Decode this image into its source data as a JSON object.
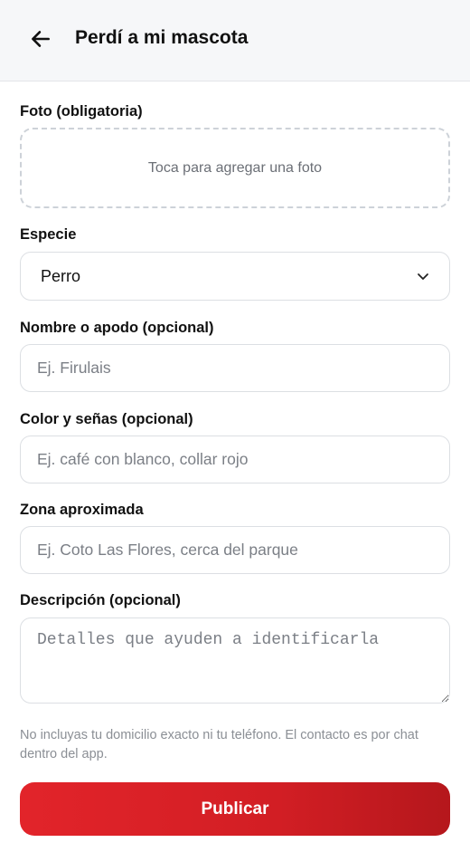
{
  "header": {
    "title": "Perdí a mi mascota",
    "back_icon": "arrow-left-icon"
  },
  "form": {
    "photo": {
      "label": "Foto (obligatoria)",
      "placeholder": "Toca para agregar una foto"
    },
    "species": {
      "label": "Especie",
      "value": "Perro",
      "icon": "chevron-down-icon"
    },
    "name": {
      "label": "Nombre o apodo (opcional)",
      "placeholder": "Ej. Firulais"
    },
    "color": {
      "label": "Color y señas (opcional)",
      "placeholder": "Ej. café con blanco, collar rojo"
    },
    "zone": {
      "label": "Zona aproximada",
      "placeholder": "Ej. Coto Las Flores, cerca del parque"
    },
    "description": {
      "label": "Descripción (opcional)",
      "placeholder": "Detalles que ayuden a identificarla"
    },
    "hint": "No incluyas tu domicilio exacto ni tu teléfono. El contacto es por chat dentro del app.",
    "submit_label": "Publicar"
  },
  "colors": {
    "accent": "#e2242a",
    "accent_dark": "#b5171c",
    "header_bg": "#f6f7f9",
    "border": "#dcdfe3"
  }
}
